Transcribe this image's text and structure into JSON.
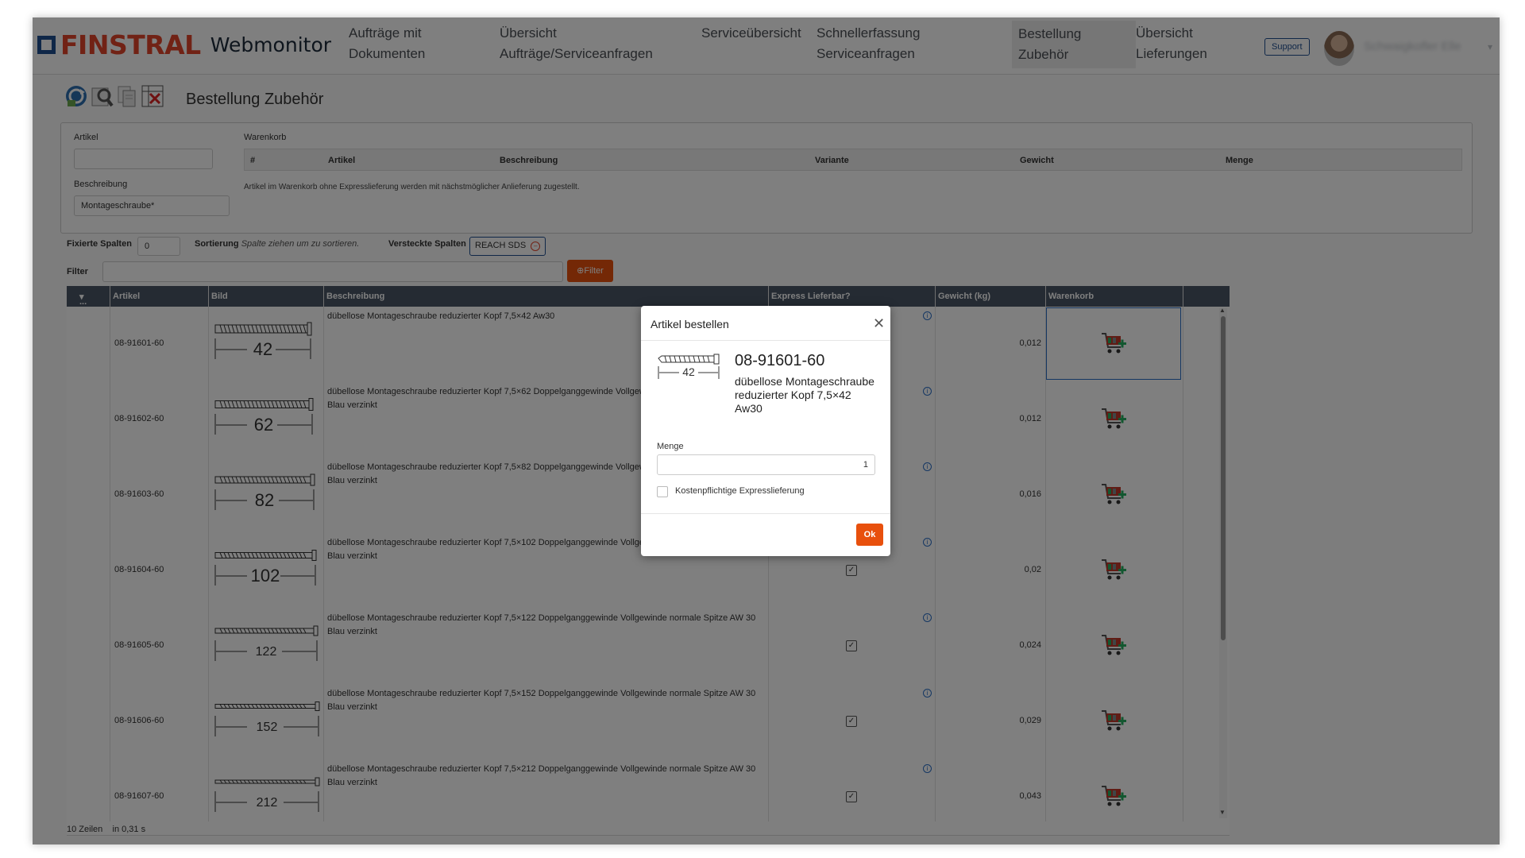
{
  "header": {
    "logo_brand": "FINSTRAL",
    "logo_sub": "Webmonitor",
    "nav": [
      "Aufträge mit Dokumenten",
      "Übersicht Aufträge/Serviceanfragen",
      "Serviceübersicht",
      "Schnellerfassung Serviceanfragen",
      "Bestellung Zubehör",
      "Übersicht Lieferungen"
    ],
    "nav_active_index": 4,
    "support_label": "Support",
    "user_name": "Schwaigkofler Elle"
  },
  "toolbar": {
    "icons": [
      "refresh-icon",
      "search-settings-icon",
      "document-copy-icon",
      "delete-grid-icon"
    ],
    "title": "Bestellung Zubehör"
  },
  "filters": {
    "artikel_label": "Artikel",
    "artikel_value": "",
    "beschreibung_label": "Beschreibung",
    "beschreibung_value": "Montageschraube*",
    "warenkorb_label": "Warenkorb",
    "warenkorb_columns": [
      "#",
      "Artikel",
      "Beschreibung",
      "Variante",
      "Gewicht",
      "Menge"
    ],
    "warenkorb_note": "Artikel im Warenkorb ohne Expresslieferung werden mit nächstmöglicher Anlieferung zugestellt."
  },
  "options": {
    "fixed_label": "Fixierte Spalten",
    "fixed_value": "0",
    "sort_label": "Sortierung",
    "sort_hint": "Spalte ziehen um zu sortieren.",
    "hidden_label": "Versteckte Spalten",
    "hidden_tag": "REACH SDS",
    "filter_label": "Filter",
    "filter_button": "Filter"
  },
  "grid": {
    "columns": [
      "...",
      "Artikel",
      "Bild",
      "Beschreibung",
      "Express Lieferbar?",
      "Gewicht (kg)",
      "Warenkorb"
    ],
    "rows": [
      {
        "artikel": "08-91601-60",
        "bild": "42",
        "beschreibung": "dübellose Montageschraube reduzierter Kopf 7,5×42 Aw30",
        "express": false,
        "gewicht": "0,012"
      },
      {
        "artikel": "08-91602-60",
        "bild": "62",
        "beschreibung": "dübellose Montageschraube reduzierter Kopf 7,5×62 Doppelganggewinde Vollgewinde normale Spitze AW 30 Blau verzinkt",
        "express": false,
        "gewicht": "0,012"
      },
      {
        "artikel": "08-91603-60",
        "bild": "82",
        "beschreibung": "dübellose Montageschraube reduzierter Kopf 7,5×82 Doppelganggewinde Vollgewinde normale Spitze AW 30 Blau verzinkt",
        "express": false,
        "gewicht": "0,016"
      },
      {
        "artikel": "08-91604-60",
        "bild": "102",
        "beschreibung": "dübellose Montageschraube reduzierter Kopf 7,5×102 Doppelganggewinde Vollgewinde normale Spitze AW 30 Blau verzinkt",
        "express": true,
        "gewicht": "0,02"
      },
      {
        "artikel": "08-91605-60",
        "bild": "122",
        "beschreibung": "dübellose Montageschraube reduzierter Kopf 7,5×122 Doppelganggewinde Vollgewinde normale Spitze AW 30 Blau verzinkt",
        "express": true,
        "gewicht": "0,024"
      },
      {
        "artikel": "08-91606-60",
        "bild": "152",
        "beschreibung": "dübellose Montageschraube reduzierter Kopf 7,5×152 Doppelganggewinde Vollgewinde normale Spitze AW 30 Blau verzinkt",
        "express": true,
        "gewicht": "0,029"
      },
      {
        "artikel": "08-91607-60",
        "bild": "212",
        "beschreibung": "dübellose Montageschraube reduzierter Kopf 7,5×212 Doppelganggewinde Vollgewinde normale Spitze AW 30 Blau verzinkt",
        "express": true,
        "gewicht": "0,043"
      }
    ],
    "footer_rows": "10 Zeilen",
    "footer_time": "in 0,31 s"
  },
  "modal": {
    "title": "Artikel bestellen",
    "image_label": "42",
    "artikel": "08-91601-60",
    "description": "dübellose Montageschraube reduzierter Kopf 7,5×42 Aw30",
    "menge_label": "Menge",
    "menge_value": "1",
    "express_label": "Kostenpflichtige Expresslieferung",
    "express_checked": false,
    "ok_label": "Ok"
  },
  "colors": {
    "brand_red": "#e3452a",
    "brand_blue": "#1f4e91",
    "accent_orange": "#e8500d",
    "grid_header": "#4a5766"
  }
}
